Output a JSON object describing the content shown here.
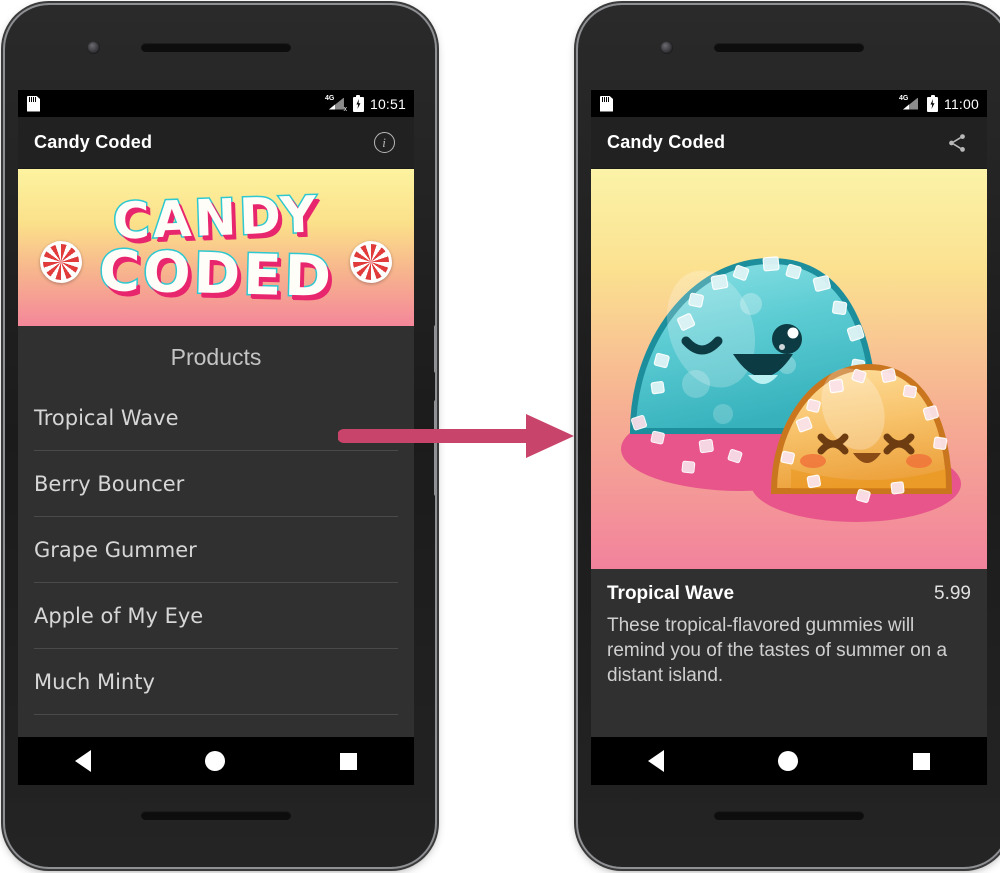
{
  "colors": {
    "accent_pink": "#c9446b",
    "appbar_bg": "#212121",
    "screen_bg": "#303030",
    "banner_top": "#fdf3a0",
    "banner_bottom": "#f4879a",
    "logo_outline": "#2ec8d0",
    "logo_shadow": "#e8266e",
    "gummy_teal": "#5ecfd6",
    "gummy_orange": "#f4b860"
  },
  "left_phone": {
    "status_bar": {
      "sd_card_icon": "sd-card-icon",
      "signal_icon": "signal-4g-no-service-icon",
      "signal_label": "4G",
      "signal_x": "x",
      "battery_icon": "battery-charging-icon",
      "time": "10:51"
    },
    "app_bar": {
      "title": "Candy Coded",
      "action_icon": "info-icon",
      "action_glyph": "i"
    },
    "banner": {
      "logo_line_1": "CANDY",
      "logo_line_2": "CODED",
      "candy_left": "peppermint-candy-icon",
      "candy_right": "peppermint-candy-icon"
    },
    "list": {
      "header": "Products",
      "items": [
        {
          "label": "Tropical Wave"
        },
        {
          "label": "Berry Bouncer"
        },
        {
          "label": "Grape Gummer"
        },
        {
          "label": "Apple of My Eye"
        },
        {
          "label": "Much Minty"
        }
      ]
    },
    "nav_bar": {
      "back": "back-nav-button",
      "home": "home-nav-button",
      "recents": "recents-nav-button"
    }
  },
  "right_phone": {
    "status_bar": {
      "sd_card_icon": "sd-card-icon",
      "signal_icon": "signal-4g-icon",
      "signal_label": "4G",
      "battery_icon": "battery-charging-icon",
      "time": "11:00"
    },
    "app_bar": {
      "title": "Candy Coded",
      "action_icon": "share-icon"
    },
    "hero": {
      "image_alt": "two-kawaii-gummy-candies",
      "big_gummy": "teal-winking-gummy",
      "small_gummy": "orange-smiling-gummy"
    },
    "detail": {
      "name": "Tropical Wave",
      "price": "5.99",
      "description": "These tropical-flavored gummies will remind you of the tastes of summer on a distant island."
    },
    "nav_bar": {
      "back": "back-nav-button",
      "home": "home-nav-button",
      "recents": "recents-nav-button"
    }
  },
  "annotation": {
    "arrow": "flow-arrow-left-to-right"
  }
}
